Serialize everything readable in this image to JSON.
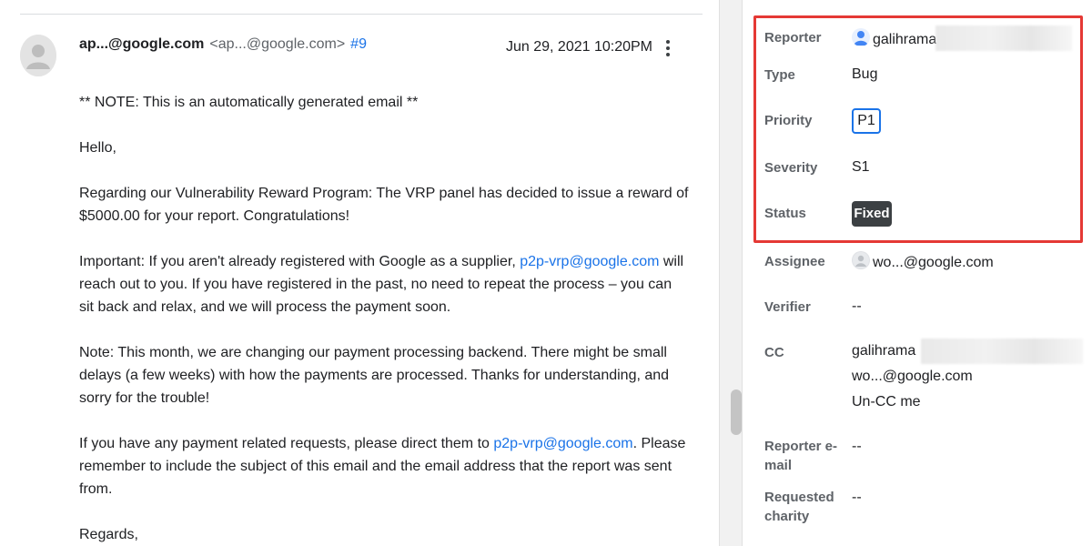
{
  "email": {
    "sender_name": "ap...@google.com",
    "sender_email": "<ap...@google.com>",
    "comment_number": "#9",
    "date": "Jun 29, 2021 10:20PM",
    "note": "** NOTE: This is an automatically generated email **",
    "greeting": "Hello,",
    "para1": "Regarding our Vulnerability Reward Program: The VRP panel has decided to issue a reward of $5000.00 for your report. Congratulations!",
    "para2_a": "Important: If you aren't already registered with Google as a supplier, ",
    "para2_link": "p2p-vrp@google.com",
    "para2_b": " will reach out to you. If you have registered in the past, no need to repeat the process – you can sit back and relax, and we will process the payment soon.",
    "para3": "Note: This month, we are changing our payment processing backend. There might be small delays (a few weeks) with how the payments are processed. Thanks for understanding, and sorry for the trouble!",
    "para4_a": "If you have any payment related requests, please direct them to ",
    "para4_link": "p2p-vrp@google.com",
    "para4_b": ". Please remember to include the subject of this email and the email address that the report was sent from.",
    "closing": "Regards,"
  },
  "details": {
    "reporter_label": "Reporter",
    "reporter_value": "galihrama",
    "type_label": "Type",
    "type_value": "Bug",
    "priority_label": "Priority",
    "priority_value": "P1",
    "severity_label": "Severity",
    "severity_value": "S1",
    "status_label": "Status",
    "status_value": "Fixed",
    "assignee_label": "Assignee",
    "assignee_value": "wo...@google.com",
    "verifier_label": "Verifier",
    "verifier_value": "--",
    "cc_label": "CC",
    "cc_value_1": "galihrama",
    "cc_value_2": "wo...@google.com",
    "uncc_label": "Un-CC me",
    "reporter_email_label_1": "Reporter e-",
    "reporter_email_label_2": "mail",
    "reporter_email_value": "--",
    "requested_charity_label_1": "Requested",
    "requested_charity_label_2": "charity",
    "requested_charity_value": "--"
  },
  "colors": {
    "link": "#1a73e8",
    "highlight": "#e53935",
    "status_fixed_bg": "#3c4043"
  },
  "icons": {
    "avatar": "person-avatar-icon",
    "menu": "more-vert-icon"
  }
}
